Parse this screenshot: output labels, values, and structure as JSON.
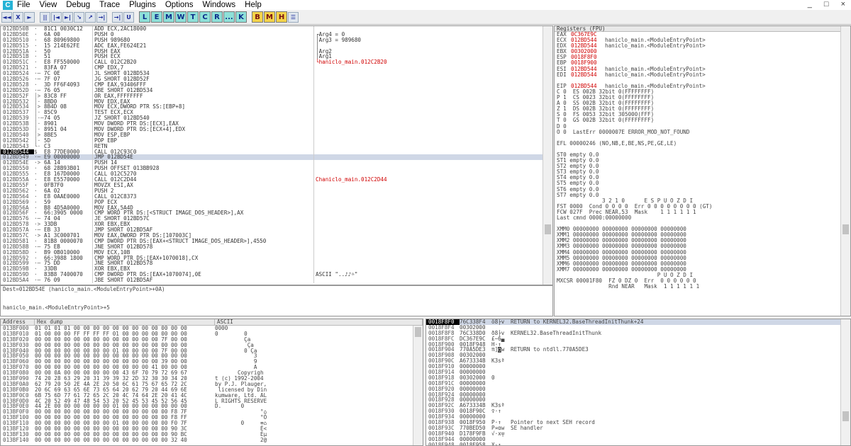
{
  "app": {
    "icon": "C",
    "menu": [
      "File",
      "View",
      "Debug",
      "Trace",
      "Plugins",
      "Options",
      "Windows",
      "Help"
    ],
    "window_buttons": [
      "_",
      "□",
      "×"
    ]
  },
  "toolbar": {
    "buttons": [
      "◄◄",
      "X",
      "►",
      "||",
      "|◄",
      "►|",
      "↘",
      "↗",
      "→|",
      "→|",
      "U"
    ],
    "letters": [
      "L",
      "E",
      "M",
      "W",
      "T",
      "C",
      "R",
      "...",
      "K"
    ],
    "letters2": [
      "B",
      "M",
      "H"
    ],
    "list_icon": "☰"
  },
  "cpu": {
    "rows": [
      [
        "012BD50B",
        "·",
        "81C1 0030C12",
        "ADD ECX,2AC18000",
        ""
      ],
      [
        "012BD50E",
        "·",
        "6A 00",
        "PUSH 0",
        "┌Arg4 = 0"
      ],
      [
        "012BD510",
        "·",
        "68 80969800",
        "PUSH 989680",
        "│Arg3 = 989680"
      ],
      [
        "012BD515",
        "·",
        "15 214E62FE",
        "ADC EAX,FE624E21",
        "│"
      ],
      [
        "012BD51A",
        "·",
        "50",
        "PUSH EAX",
        "│Arg2"
      ],
      [
        "012BD51B",
        "·",
        "51",
        "PUSH ECX",
        "│Arg1"
      ],
      [
        "012BD51C",
        "·",
        "E8 FF550000",
        "CALL 012C2B20",
        "└haniclo_main.012C2B20"
      ],
      [
        "012BD521",
        "·",
        "83FA 07",
        "CMP EDX,7",
        ""
      ],
      [
        "012BD524",
        "·─",
        "7C 0E",
        "JL SHORT 012BD534",
        ""
      ],
      [
        "012BD526",
        "·─",
        "7F 07",
        "JG SHORT 012BD52F",
        ""
      ],
      [
        "012BD528",
        "·",
        "3D FF6F4093",
        "CMP EAX,93406FFF",
        ""
      ],
      [
        "012BD52D",
        "·─",
        "76 05",
        "JBE SHORT 012BD534",
        ""
      ],
      [
        "012BD52F",
        "│>",
        "83C8 FF",
        "OR EAX,FFFFFFFF",
        ""
      ],
      [
        "012BD532",
        "│·",
        "8BD0",
        "MOV EDX,EAX",
        ""
      ],
      [
        "012BD534",
        "│>",
        "8B4D 08",
        "MOV ECX,DWORD PTR SS:[EBP+8]",
        ""
      ],
      [
        "012BD537",
        "│·",
        "85C9",
        "TEST ECX,ECX",
        ""
      ],
      [
        "012BD539",
        "│·─",
        "74 05",
        "JZ SHORT 012BD540",
        ""
      ],
      [
        "012BD53B",
        "│·",
        "8901",
        "MOV DWORD PTR DS:[ECX],EAX",
        ""
      ],
      [
        "012BD53D",
        "│·",
        "8951 04",
        "MOV DWORD PTR DS:[ECX+4],EDX",
        ""
      ],
      [
        "012BD540",
        "│>",
        "8BE5",
        "MOV ESP,EBP",
        ""
      ],
      [
        "012BD542",
        "│·",
        "5D",
        "POP EBP",
        ""
      ],
      [
        "012BD543",
        "└·",
        "C3",
        "RETN",
        ""
      ],
      [
        "012BD544",
        "$",
        "E8 77DE0000",
        "CALL 012C93C0",
        ""
      ],
      [
        "012BD549",
        "·─",
        "E9 00000000",
        "JMP 012BD54E",
        ""
      ],
      [
        "012BD54E",
        "·>",
        "6A 14",
        "PUSH 14",
        ""
      ],
      [
        "012BD550",
        "·",
        "68 28B93B01",
        "PUSH OFFSET 013BB928",
        ""
      ],
      [
        "012BD555",
        "·",
        "E8 167D0000",
        "CALL 012C5270",
        ""
      ],
      [
        "012BD55A",
        "·",
        "E8 E5570000",
        "CALL 012C2D44",
        "Chaniclo_main.012C2D44"
      ],
      [
        "012BD55F",
        "·",
        "0FB7F0",
        "MOVZX ESI,AX",
        ""
      ],
      [
        "012BD562",
        "·",
        "6A 02",
        "PUSH 2",
        ""
      ],
      [
        "012BD564",
        "·",
        "E8 0AAE0000",
        "CALL 012C8373",
        ""
      ],
      [
        "012BD569",
        "·",
        "59",
        "POP ECX",
        ""
      ],
      [
        "012BD56A",
        "·",
        "B8 4D5A0000",
        "MOV EAX,5A4D",
        ""
      ],
      [
        "012BD56F",
        "·",
        "66:3905 0000",
        "CMP WORD PTR DS:[<STRUCT IMAGE_DOS_HEADER>],AX",
        ""
      ],
      [
        "012BD576",
        "·─",
        "74 04",
        "JE SHORT 012BD57C",
        ""
      ],
      [
        "012BD578",
        "·>",
        "33DB",
        "XOR EBX,EBX",
        ""
      ],
      [
        "012BD57A",
        "·─",
        "EB 33",
        "JMP SHORT 012BD5AF",
        ""
      ],
      [
        "012BD57C",
        "·>",
        "A1 3C000701",
        "MOV EAX,DWORD PTR DS:[107003C]",
        ""
      ],
      [
        "012BD581",
        "·",
        "81B8 0000070",
        "CMP DWORD PTR DS:[EAX+<STRUCT IMAGE_DOS_HEADER>],4550",
        ""
      ],
      [
        "012BD58B",
        "·─",
        "75 EB",
        "JNE SHORT 012BD578",
        ""
      ],
      [
        "012BD58D",
        "·",
        "B9 0B010000",
        "MOV ECX,10B",
        ""
      ],
      [
        "012BD592",
        "·",
        "66:3988 1800",
        "CMP WORD PTR DS:[EAX+1070018],CX",
        ""
      ],
      [
        "012BD599",
        "·─",
        "75 DD",
        "JNE SHORT 012BD578",
        ""
      ],
      [
        "012BD59B",
        "·",
        "33DB",
        "XOR EBX,EBX",
        ""
      ],
      [
        "012BD59D",
        "·",
        "83B8 7400070",
        "CMP DWORD PTR DS:[EAX+1070074],0E",
        "ASCII \"..♪♪☼\""
      ],
      [
        "012BD5A4",
        "·─",
        "76 09",
        "JBE SHORT 012BD5AF",
        ""
      ]
    ],
    "info_line1": "Dest=012BD54E (haniclo_main.<ModuleEntryPoint>+0A)",
    "info_line2": "haniclo_main.<ModuleEntryPoint>+5"
  },
  "registers": {
    "title": "Registers (FPU)",
    "rows": [
      [
        "EAX",
        "0C367E9C",
        ""
      ],
      [
        "ECX",
        "012BD544",
        "haniclo_main.<ModuleEntryPoint>"
      ],
      [
        "EDX",
        "012BD544",
        "haniclo_main.<ModuleEntryPoint>"
      ],
      [
        "EBX",
        "00302000",
        ""
      ],
      [
        "ESP",
        "0018F8F0",
        ""
      ],
      [
        "EBP",
        "0018F900",
        ""
      ],
      [
        "ESI",
        "012BD544",
        "haniclo_main.<ModuleEntryPoint>"
      ],
      [
        "EDI",
        "012BD544",
        "haniclo_main.<ModuleEntryPoint>"
      ],
      [
        "",
        "",
        " "
      ],
      [
        "EIP",
        "012BD544",
        "haniclo_main.<ModuleEntryPoint>"
      ]
    ],
    "lines": [
      "C 0  ES 002B 32bit 0(FFFFFFFF)",
      "P 1  CS 0023 32bit 0(FFFFFFFF)",
      "A 0  SS 002B 32bit 0(FFFFFFFF)",
      "Z 1  DS 002B 32bit 0(FFFFFFFF)",
      "S 0  FS 0053 32bit 305000(FFF)",
      "T 0  GS 002B 32bit 0(FFFFFFFF)",
      "D 0",
      "O 0  LastErr 0000007E ERROR_MOD_NOT_FOUND",
      "",
      "EFL 00000246 (NO,NB,E,BE,NS,PE,GE,LE)",
      "",
      "ST0 empty 0.0",
      "ST1 empty 0.0",
      "ST2 empty 0.0",
      "ST3 empty 0.0",
      "ST4 empty 0.0",
      "ST5 empty 0.0",
      "ST6 empty 0.0",
      "ST7 empty 0.0",
      "              3 2 1 0      E S P U O Z D I",
      "FST 0000  Cond 0 0 0 0  Err 0 0 0 0 0 0 0 0 (GT)",
      "FCW 027F  Prec NEAR,53  Mask    1 1 1 1 1 1",
      "Last cmnd 0000:00000000",
      "",
      "XMM0 00000000 00000000 00000000 00000000",
      "XMM1 00000000 00000000 00000000 00000000",
      "XMM2 00000000 00000000 00000000 00000000",
      "XMM3 00000000 00000000 00000000 00000000",
      "XMM4 00000000 00000000 00000000 00000000",
      "XMM5 00000000 00000000 00000000 00000000",
      "XMM6 00000000 00000000 00000000 00000000",
      "XMM7 00000000 00000000 00000000 00000000",
      "                               P U O Z D I",
      "MXCSR 00001F80  FZ 0 DZ 0  Err  0 0 0 0 0 0",
      "                Rnd NEAR   Mask  1 1 1 1 1 1"
    ]
  },
  "dump": {
    "headers": [
      "Address",
      "Hex dump",
      "ASCII"
    ],
    "rows": [
      [
        "013BF000",
        "01 01 01 01 00 00 00 00 00 00 00 00 00 00 00 00",
        "0000"
      ],
      [
        "013BF010",
        "01 00 00 00 FF FF FF FF 01 00 00 00 00 00 00 00",
        "0        0"
      ],
      [
        "013BF020",
        "00 00 00 00 00 00 00 00 00 00 00 00 00 7F 00 00",
        "         Ça"
      ],
      [
        "013BF030",
        "00 00 00 00 00 00 00 00 00 00 00 00 00 00 00 00",
        "          Ça"
      ],
      [
        "013BF040",
        "00 00 00 00 00 00 00 00 01 00 00 00 00 7F 00 00",
        "         0 Ça"
      ],
      [
        "013BF050",
        "00 00 00 00 00 00 00 00 00 00 00 00 00 00 00 00",
        "            3"
      ],
      [
        "013BF060",
        "00 00 00 00 00 00 00 00 00 00 00 00 00 39 00 00",
        "            9"
      ],
      [
        "013BF070",
        "00 00 00 00 00 00 00 00 00 00 00 00 41 00 00 00",
        "            A"
      ],
      [
        "013BF080",
        "00 00 0A 00 00 00 00 00 00 43 6F 70 79 72 69 67",
        "       Copyrigh"
      ],
      [
        "013BF090",
        "74 20 28 63 29 20 31 39 39 32 2D 32 30 30 34 20",
        "t (c) 1992-2004"
      ],
      [
        "013BF0A0",
        "62 79 20 50 2E 4A 2E 20 50 6C 61 75 67 65 72 2C",
        "by P.J. Plauger,"
      ],
      [
        "013BF0B0",
        "20 6C 69 63 65 6E 73 65 64 20 62 79 20 44 69 6E",
        " licensed by Din"
      ],
      [
        "013BF0C0",
        "6B 75 6D 77 61 72 65 2C 20 4C 74 64 2E 20 41 4C",
        "kumware, Ltd. AL"
      ],
      [
        "013BF0D0",
        "4C 20 52 49 47 48 54 53 20 52 45 53 45 52 56 45",
        "L RIGHTS RESERVE"
      ],
      [
        "013BF0E0",
        "44 2E 00 00 00 00 00 00 01 00 00 00 00 00 00 00",
        "D.      0"
      ],
      [
        "013BF0F0",
        "00 00 00 00 00 00 00 00 00 00 00 00 00 00 F8 7F",
        "              °⌂"
      ],
      [
        "013BF100",
        "00 00 00 00 00 00 00 00 00 00 00 00 00 00 F8 FF",
        "              °Ö"
      ],
      [
        "013BF110",
        "00 00 00 00 00 00 00 00 01 00 00 00 00 00 F0 7F",
        "        0     ≡⌂"
      ],
      [
        "013BF120",
        "00 00 00 00 00 00 00 00 00 00 00 00 00 00 90 3C",
        "              É<"
      ],
      [
        "013BF130",
        "00 00 00 00 00 00 00 00 00 00 00 00 00 00 90 BC",
        "              Éμ"
      ],
      [
        "013BF140",
        "00 00 00 00 00 00 00 00 00 00 00 00 00 00 32 40",
        "              2@"
      ]
    ]
  },
  "stack": {
    "rows": [
      [
        "0018F8F0",
        "76C338F4",
        "ô8├v",
        "RETURN to KERNEL32.BaseThreadInitThunk+24"
      ],
      [
        "0018F8F4",
        "00302000",
        "",
        ""
      ],
      [
        "0018F8F8",
        "76C338D0",
        "ð8├v",
        "KERNEL32.BaseThreadInitThunk"
      ],
      [
        "0018F8FC",
        "DC367E9C",
        "£~6▄",
        ""
      ],
      [
        "0018F900",
        "0018F948",
        "H·↑",
        ""
      ],
      [
        "0018F904",
        "770A5DE3",
        "π]◙w",
        "RETURN to ntdll.770A5DE3"
      ],
      [
        "0018F908",
        "00302000",
        "",
        ""
      ],
      [
        "0018F90C",
        "A673334B",
        "K3sª",
        ""
      ],
      [
        "0018F910",
        "00000000",
        "",
        ""
      ],
      [
        "0018F914",
        "00000000",
        "",
        ""
      ],
      [
        "0018F918",
        "00302000",
        "0",
        ""
      ],
      [
        "0018F91C",
        "00000000",
        "",
        ""
      ],
      [
        "0018F920",
        "00000000",
        "",
        ""
      ],
      [
        "0018F924",
        "00000000",
        "",
        ""
      ],
      [
        "0018F928",
        "00000000",
        "",
        ""
      ],
      [
        "0018F92C",
        "A673334B",
        "K3sª",
        ""
      ],
      [
        "0018F930",
        "0018F90C",
        "♀·↑",
        ""
      ],
      [
        "0018F934",
        "00000000",
        "",
        ""
      ],
      [
        "0018F938",
        "0018F950",
        "P·↑",
        "Pointer to next SEH record"
      ],
      [
        "0018F93C",
        "770BED50",
        "P¤αw",
        "SE handler"
      ],
      [
        "0018F940",
        "D178F9FB",
        "√·x╤",
        ""
      ],
      [
        "0018F944",
        "00000000",
        "",
        ""
      ],
      [
        "0018F948",
        "0018F958",
        "X·↑",
        ""
      ]
    ]
  },
  "colors": {
    "red": "#d00000",
    "selection": "#000000",
    "highlight": "#cfd7e6"
  }
}
